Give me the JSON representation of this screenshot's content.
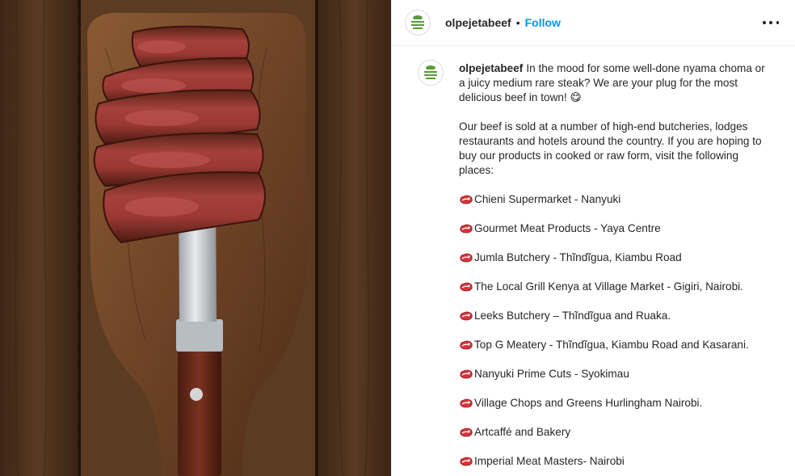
{
  "post": {
    "username": "olpejetabeef",
    "separator": "•",
    "follow_label": "Follow",
    "more_icon": "more-options-icon",
    "avatar_logo_text": "OL PEJETA BEEF"
  },
  "caption": {
    "username": "olpejetabeef",
    "intro": "In the mood for some well-done nyama choma or a juicy medium rare steak? We are your plug for the most delicious beef in town! 😋",
    "paragraph2": "Our beef is sold at a number of high-end butcheries, lodges restaurants and hotels around the country. If you are hoping to buy our products in cooked or raw form, visit the following places:",
    "places": [
      "Chieni Supermarket - Nanyuki",
      "Gourmet Meat Products - Yaya Centre",
      "Jumla Butchery - Thĩndĩgua, Kiambu Road",
      "The Local Grill Kenya at Village Market - Gigiri, Nairobi.",
      "Leeks Butchery – Thĩndĩgua and Ruaka.",
      "Top G Meatery - Thĩndĩgua, Kiambu Road and Kasarani.",
      "Nanyuki Prime Cuts - Syokimau",
      "Village Chops and Greens Hurlingham Nairobi.",
      "Artcaffé and Bakery",
      "Imperial Meat Masters- Nairobi"
    ],
    "list_icon": "meat-icon"
  },
  "colors": {
    "follow": "#0095f6",
    "text": "#262626",
    "border": "#efefef",
    "logo_green": "#5b9a3a"
  }
}
